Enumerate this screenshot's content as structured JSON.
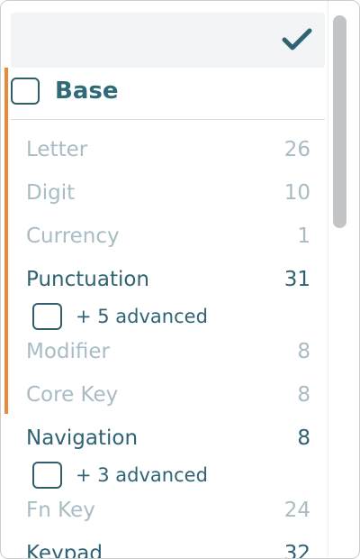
{
  "header": {
    "confirm_icon": "checkmark-icon"
  },
  "colors": {
    "accent": "#e88a3a",
    "primary_text": "#2f6373",
    "dim_text": "#a8bcc4",
    "group_title": "#2e6a77"
  },
  "group": {
    "label": "Base",
    "checked": false
  },
  "items": [
    {
      "name": "Letter",
      "count": "26",
      "state": "dim"
    },
    {
      "name": "Digit",
      "count": "10",
      "state": "dim"
    },
    {
      "name": "Currency",
      "count": "1",
      "state": "dim"
    },
    {
      "name": "Punctuation",
      "count": "31",
      "state": "active",
      "advanced": "+ 5 advanced"
    },
    {
      "name": "Modifier",
      "count": "8",
      "state": "dim"
    },
    {
      "name": "Core Key",
      "count": "8",
      "state": "dim"
    },
    {
      "name": "Navigation",
      "count": "8",
      "state": "active",
      "advanced": "+ 3 advanced"
    },
    {
      "name": "Fn Key",
      "count": "24",
      "state": "dim"
    },
    {
      "name": "Keypad",
      "count": "32",
      "state": "active"
    }
  ]
}
